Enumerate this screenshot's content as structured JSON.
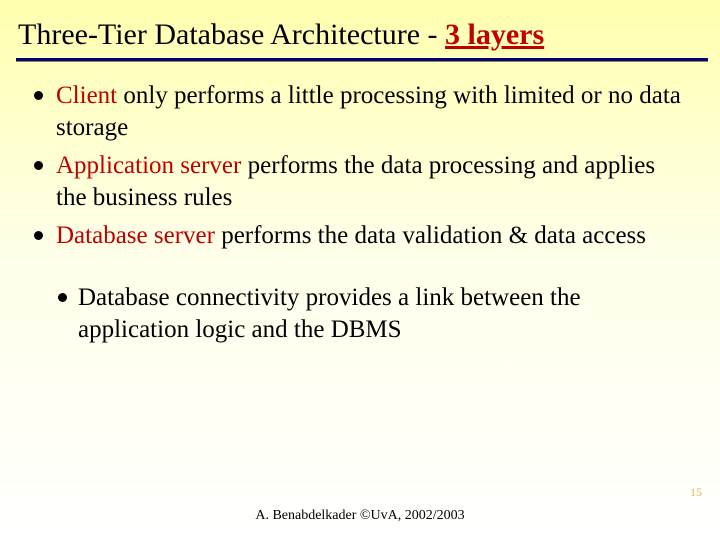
{
  "title": {
    "prefix": "Three-Tier Database Architecture - ",
    "emph": "3 layers"
  },
  "bullets": [
    {
      "kw": "Client",
      "rest": " only performs a little processing with limited or no data storage"
    },
    {
      "kw": "Application server",
      "rest": " performs the data processing and applies the business rules"
    },
    {
      "kw": "Database server",
      "rest": " performs the data validation & data access"
    }
  ],
  "subbullet": "Database connectivity provides a link between the application logic and the DBMS",
  "footer": "A. Benabdelkader ©UvA, 2002/2003",
  "pagenum": "15"
}
